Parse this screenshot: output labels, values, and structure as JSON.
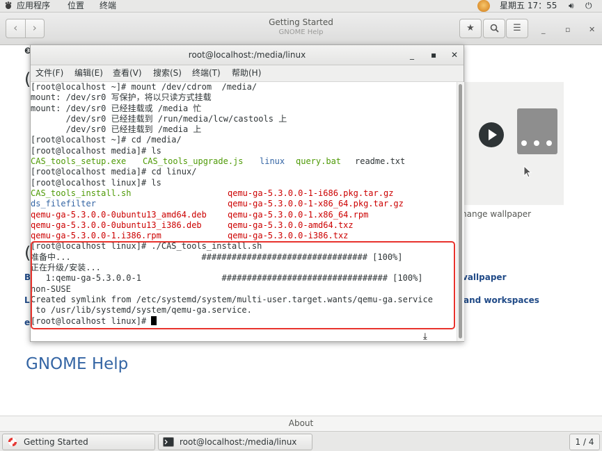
{
  "top_panel": {
    "applications": "应用程序",
    "places": "位置",
    "terminal": "终端",
    "clock": "星期五 17：55"
  },
  "help_window": {
    "title": "Getting Started",
    "subtitle": "GNOME Help",
    "wallpaper_caption": "hange wallpaper",
    "link_wallpaper": "vallpaper",
    "link_workspaces": "and workspaces",
    "gnome_help": "GNOME Help",
    "about": "About"
  },
  "terminal": {
    "title": "root@localhost:/media/linux",
    "menu": [
      "文件(F)",
      "编辑(E)",
      "查看(V)",
      "搜索(S)",
      "终端(T)",
      "帮助(H)"
    ],
    "lines": {
      "l1": "[root@localhost ~]# mount /dev/cdrom  /media/",
      "l2": "mount: /dev/sr0 写保护，将以只读方式挂载",
      "l3": "mount: /dev/sr0 已经挂载或 /media 忙",
      "l4": "       /dev/sr0 已经挂载到 /run/media/lcw/castools 上",
      "l5": "       /dev/sr0 已经挂载到 /media 上",
      "l6": "[root@localhost ~]# cd /media/",
      "l7": "[root@localhost media]# ls",
      "l8_a": "CAS_tools_setup.exe",
      "l8_b": "CAS_tools_upgrade.js",
      "l8_c": "linux",
      "l8_d": "query.bat",
      "l8_e": "readme.txt",
      "l9": "[root@localhost media]# cd linux/",
      "l10": "[root@localhost linux]# ls",
      "l11_a": "CAS_tools_install.sh",
      "l11_b": "qemu-ga-5.3.0.0-1-i686.pkg.tar.gz",
      "l12_a": "ds_filefilter",
      "l12_b": "qemu-ga-5.3.0.0-1-x86_64.pkg.tar.gz",
      "l13_a": "qemu-ga-5.3.0.0-0ubuntu13_amd64.deb",
      "l13_b": "qemu-ga-5.3.0.0-1.x86_64.rpm",
      "l14_a": "qemu-ga-5.3.0.0-0ubuntu13_i386.deb",
      "l14_b": "qemu-ga-5.3.0.0-amd64.txz",
      "l15_a": "qemu-ga-5.3.0.0-1.i386.rpm",
      "l15_b": "qemu-ga-5.3.0.0-i386.txz",
      "l16": "[root@localhost linux]# ./CAS_tools_install.sh",
      "l17": "准备中...                          ################################# [100%]",
      "l18": "正在升级/安装...",
      "l19": "   1:qemu-ga-5.3.0.0-1                ################################# [100%]",
      "l20": "non-SUSE",
      "l21": "Created symlink from /etc/systemd/system/multi-user.target.wants/qemu-ga.service",
      "l22": " to /usr/lib/systemd/system/qemu-ga.service.",
      "l23": "[root@localhost linux]# "
    }
  },
  "taskbar": {
    "task1": "Getting Started",
    "task2": "root@localhost:/media/linux",
    "pager": "1 / 4"
  },
  "colors": {
    "prompt_text": "#000000",
    "exec_green": "#4e9a06",
    "dir_blue": "#3465a4",
    "archive_red": "#cc0000",
    "highlight_box": "#e8322c"
  }
}
